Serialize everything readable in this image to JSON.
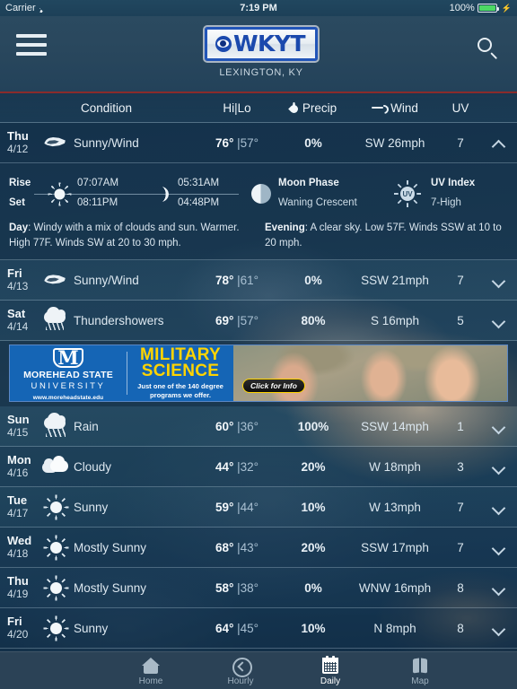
{
  "status_bar": {
    "carrier": "Carrier",
    "wifi_icon": "wifi-icon",
    "time": "7:19 PM",
    "battery_percent": "100%",
    "battery_icon": "battery-full-icon",
    "charging_icon": "charging-bolt-icon",
    "battery_color": "#4cd964"
  },
  "nav": {
    "menu_icon": "hamburger-menu-icon",
    "logo_eye_icon": "cbs-eye-icon",
    "logo_text": "WKYT",
    "location": "LEXINGTON, KY",
    "search_icon": "search-icon",
    "accent_rule_color": "#8a2b2b",
    "logo_blue": "#1b49ad"
  },
  "columns": {
    "condition": "Condition",
    "hi_lo": "Hi|Lo",
    "precip": "Precip",
    "precip_icon": "water-drop-icon",
    "wind": "Wind",
    "wind_icon": "wind-swirl-icon",
    "uv": "UV"
  },
  "forecast": [
    {
      "day": "Thu",
      "date": "4/12",
      "icon": "wind-swirl-icon",
      "condition": "Sunny/Wind",
      "hi": "76°",
      "lo": "|57°",
      "precip": "0%",
      "wind": "SW 26mph",
      "uv": "7",
      "expanded": true,
      "chevron": "chevron-up-icon"
    },
    {
      "day": "Fri",
      "date": "4/13",
      "icon": "wind-swirl-icon",
      "condition": "Sunny/Wind",
      "hi": "78°",
      "lo": "|61°",
      "precip": "0%",
      "wind": "SSW 21mph",
      "uv": "7",
      "expanded": false,
      "chevron": "chevron-down-icon"
    },
    {
      "day": "Sat",
      "date": "4/14",
      "icon": "thunderstorm-icon",
      "condition": "Thundershowers",
      "hi": "69°",
      "lo": "|57°",
      "precip": "80%",
      "wind": "S 16mph",
      "uv": "5",
      "expanded": false,
      "chevron": "chevron-down-icon"
    },
    {
      "day": "Sun",
      "date": "4/15",
      "icon": "rain-cloud-icon",
      "condition": "Rain",
      "hi": "60°",
      "lo": "|36°",
      "precip": "100%",
      "wind": "SSW 14mph",
      "uv": "1",
      "expanded": false,
      "chevron": "chevron-down-icon"
    },
    {
      "day": "Mon",
      "date": "4/16",
      "icon": "cloudy-icon",
      "condition": "Cloudy",
      "hi": "44°",
      "lo": "|32°",
      "precip": "20%",
      "wind": "W 18mph",
      "uv": "3",
      "expanded": false,
      "chevron": "chevron-down-icon"
    },
    {
      "day": "Tue",
      "date": "4/17",
      "icon": "sun-icon",
      "condition": "Sunny",
      "hi": "59°",
      "lo": "|44°",
      "precip": "10%",
      "wind": "W 13mph",
      "uv": "7",
      "expanded": false,
      "chevron": "chevron-down-icon"
    },
    {
      "day": "Wed",
      "date": "4/18",
      "icon": "sun-icon",
      "condition": "Mostly Sunny",
      "hi": "68°",
      "lo": "|43°",
      "precip": "20%",
      "wind": "SSW 17mph",
      "uv": "7",
      "expanded": false,
      "chevron": "chevron-down-icon"
    },
    {
      "day": "Thu",
      "date": "4/19",
      "icon": "sun-icon",
      "condition": "Mostly Sunny",
      "hi": "58°",
      "lo": "|38°",
      "precip": "0%",
      "wind": "WNW 16mph",
      "uv": "8",
      "expanded": false,
      "chevron": "chevron-down-icon"
    },
    {
      "day": "Fri",
      "date": "4/20",
      "icon": "sun-icon",
      "condition": "Sunny",
      "hi": "64°",
      "lo": "|45°",
      "precip": "10%",
      "wind": "N 8mph",
      "uv": "8",
      "expanded": false,
      "chevron": "chevron-down-icon"
    }
  ],
  "detail": {
    "rise_label": "Rise",
    "set_label": "Set",
    "sun_icon": "sun-icon",
    "sunrise": "07:07AM",
    "sunset": "08:11PM",
    "moon_icon": "crescent-moon-icon",
    "moonrise": "05:31AM",
    "moonset": "04:48PM",
    "moon_phase_icon": "moon-phase-icon",
    "moon_phase_label": "Moon Phase",
    "moon_phase_value": "Waning Crescent",
    "uv_icon": "uv-sun-icon",
    "uv_icon_text": "UV",
    "uv_index_label": "UV Index",
    "uv_index_value": "7-High",
    "day_label": "Day",
    "day_text": ": Windy with a mix of clouds and sun. Warmer. High 77F. Winds SW at 20 to 30 mph.",
    "evening_label": "Evening",
    "evening_text": ": A clear sky. Low 57F. Winds SSW at 10 to 20 mph."
  },
  "ad": {
    "logo_icon": "morehead-m-icon",
    "school_line1": "MOREHEAD STATE",
    "school_line2": "UNIVERSITY",
    "url": "www.moreheadstate.edu",
    "headline1": "MILITARY",
    "headline2": "SCIENCE",
    "subline": "Just one of the 140 degree programs we offer.",
    "cta": "Click for Info",
    "brand_blue": "#1565b5",
    "brand_yellow": "#ffd400"
  },
  "tabs": [
    {
      "label": "Home",
      "icon": "home-icon",
      "active": false
    },
    {
      "label": "Hourly",
      "icon": "clock-icon",
      "active": false
    },
    {
      "label": "Daily",
      "icon": "calendar-icon",
      "active": true
    },
    {
      "label": "Map",
      "icon": "map-icon",
      "active": false
    }
  ]
}
